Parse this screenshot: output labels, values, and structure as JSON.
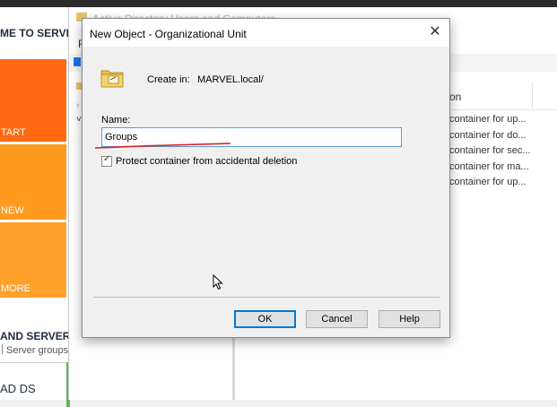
{
  "server_manager": {
    "welcome": "ME TO SERVE",
    "tiles": [
      "TART",
      "NEW",
      "MORE"
    ],
    "section_title": "AND SERVER",
    "section_sub": "Server groups",
    "ad_ds": "AD DS"
  },
  "aduc": {
    "title": "Active Directory Users and Computers",
    "menu_fragment": "F",
    "column_header": "on",
    "descriptions": [
      "container for up...",
      "container for do...",
      "container for sec...",
      "container for ma...",
      "container for up..."
    ]
  },
  "dialog": {
    "title": "New Object - Organizational Unit",
    "create_in_label": "Create in:",
    "create_in_value": "MARVEL.local/",
    "name_label": "Name:",
    "name_value": "Groups",
    "protect_label": "Protect container from accidental deletion",
    "protect_checked": true,
    "ok_label": "OK",
    "cancel_label": "Cancel",
    "help_label": "Help"
  },
  "colors": {
    "tile_1": "#ff6a10",
    "tile_2": "#ff9a1f",
    "tile_3": "#ffa12b",
    "annotation_red": "#d8232a",
    "focus_blue": "#0078d7"
  }
}
